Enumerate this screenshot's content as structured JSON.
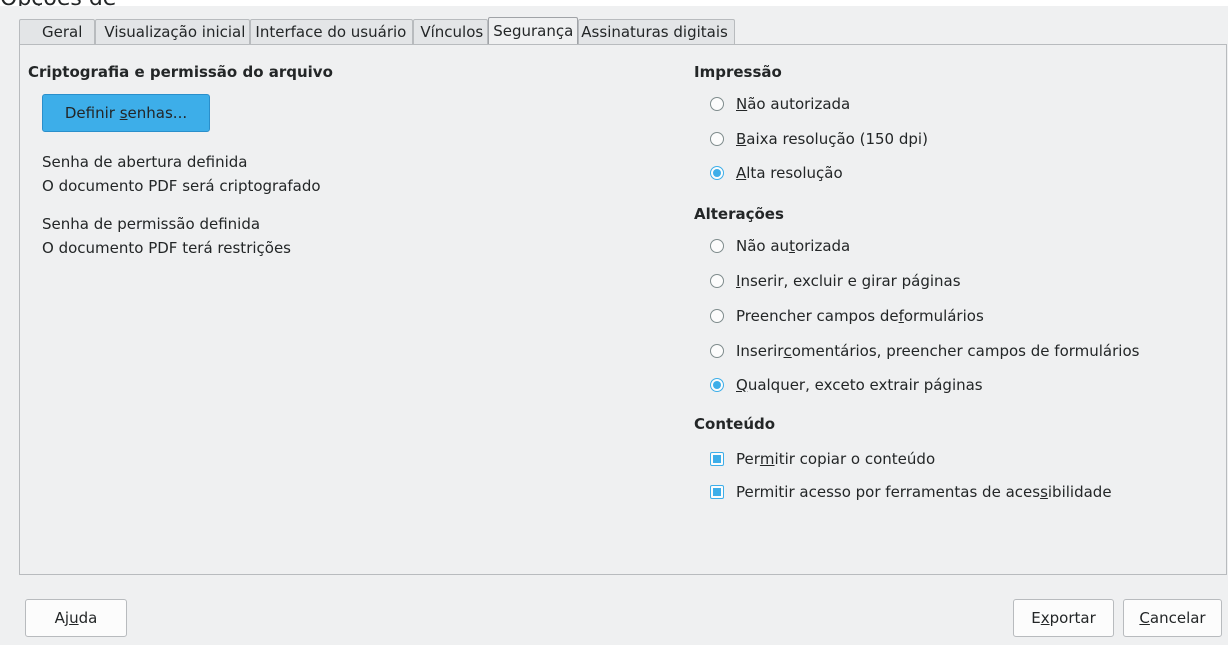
{
  "window": {
    "title": "Opções de"
  },
  "tabs": [
    {
      "label": "Geral"
    },
    {
      "label": "Visualização inicial"
    },
    {
      "label": "Interface do usuário"
    },
    {
      "label": "Vínculos"
    },
    {
      "label": "Segurança"
    },
    {
      "label": "Assinaturas digitais"
    }
  ],
  "selected_tab": "Segurança",
  "encryption": {
    "title": "Criptografia e permissão do arquivo",
    "set_passwords_button": {
      "pre": "Definir ",
      "mn": "s",
      "post": "enhas..."
    },
    "open_password_status": "Senha de abertura definida",
    "open_password_note": "O documento PDF será criptografado",
    "permission_password_status": "Senha de permissão definida",
    "permission_password_note": "O documento PDF terá restrições"
  },
  "printing": {
    "title": "Impressão",
    "options": [
      {
        "pre": "",
        "mn": "N",
        "post": "ão autorizada",
        "selected": false
      },
      {
        "pre": "",
        "mn": "B",
        "post": "aixa resolução (150 dpi)",
        "selected": false
      },
      {
        "pre": "",
        "mn": "A",
        "post": "lta resolução",
        "selected": true
      }
    ]
  },
  "changes": {
    "title": "Alterações",
    "options": [
      {
        "pre": "Não au",
        "mn": "t",
        "post": "orizada",
        "selected": false
      },
      {
        "pre": "",
        "mn": "I",
        "post": "nserir, excluir e girar páginas",
        "selected": false
      },
      {
        "pre": "Preencher campos de ",
        "mn": "f",
        "post": "ormulários",
        "selected": false
      },
      {
        "pre": "Inserir ",
        "mn": "c",
        "post": "omentários, preencher campos de formulários",
        "selected": false
      },
      {
        "pre": "",
        "mn": "Q",
        "post": "ualquer, exceto extrair páginas",
        "selected": true
      }
    ]
  },
  "content": {
    "title": "Conteúdo",
    "options": [
      {
        "pre": "Per",
        "mn": "m",
        "post": "itir copiar o conteúdo",
        "checked": true
      },
      {
        "pre": "Permitir acesso por ferramentas de aces",
        "mn": "s",
        "post": "ibilidade",
        "checked": true
      }
    ]
  },
  "footer": {
    "help_button": {
      "pre": "Aj",
      "mn": "u",
      "post": "da"
    },
    "export_button": {
      "pre": "E",
      "mn": "x",
      "post": "portar"
    },
    "cancel_button": {
      "pre": "",
      "mn": "C",
      "post": "ancelar"
    }
  },
  "colors": {
    "accent": "#3daee9",
    "window_bg": "#eff0f1",
    "text": "#232627"
  }
}
